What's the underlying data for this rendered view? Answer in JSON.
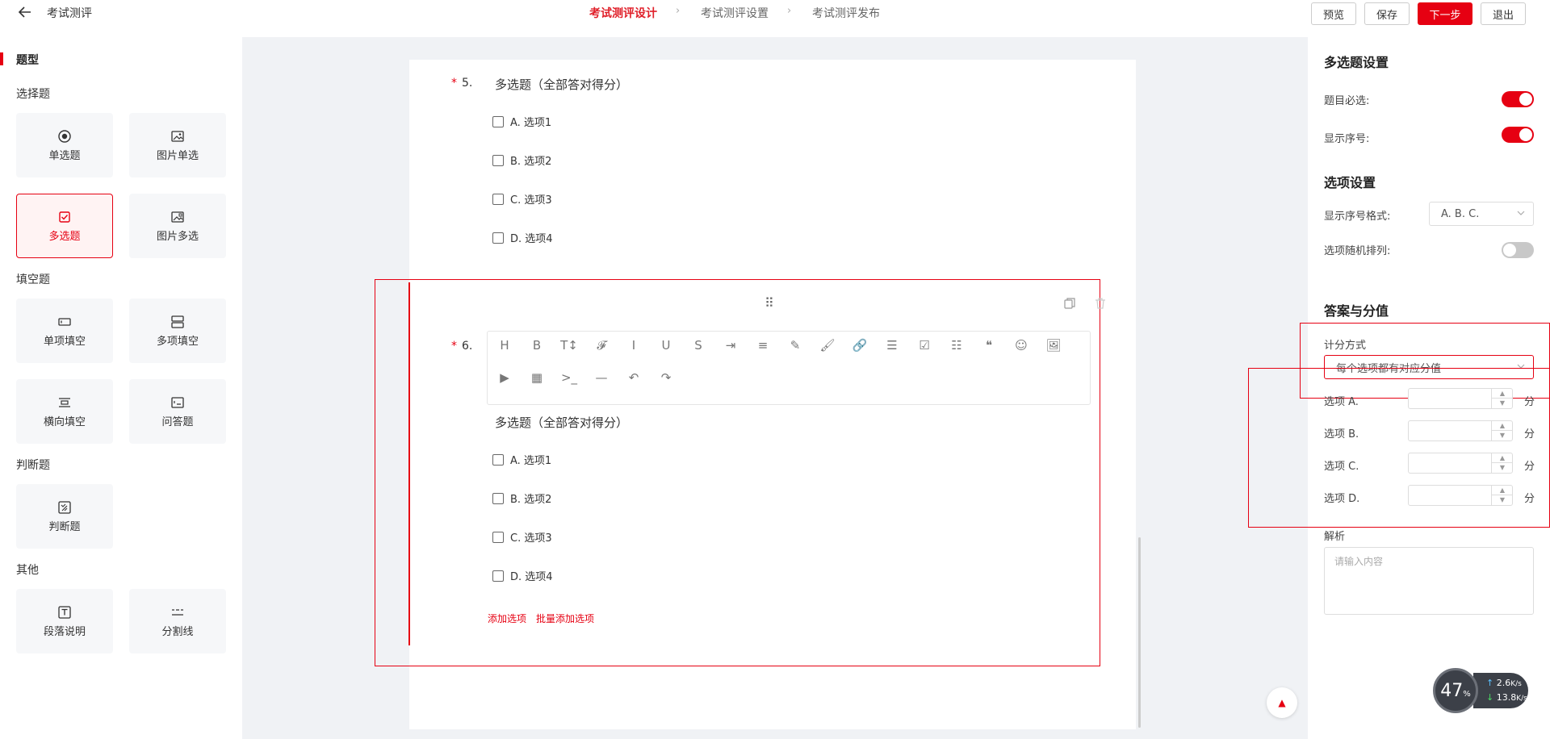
{
  "header": {
    "back_label": "←",
    "title": "考试测评",
    "steps": [
      "考试测评设计",
      "考试测评设置",
      "考试测评发布"
    ],
    "step_sep": "›",
    "buttons": {
      "preview": "预览",
      "save": "保存",
      "next": "下一步",
      "exit": "退出"
    }
  },
  "palette": {
    "title": "题型",
    "groups": {
      "choice": "选择题",
      "fill": "填空题",
      "judge": "判断题",
      "other": "其他"
    },
    "items": {
      "single": "单选题",
      "image_single": "图片单选",
      "multi": "多选题",
      "image_multi": "图片多选",
      "single_fill": "单项填空",
      "multi_fill": "多项填空",
      "horizontal_fill": "横向填空",
      "qa": "问答题",
      "judge": "判断题",
      "paragraph": "段落说明",
      "divider": "分割线"
    },
    "active_item": "multi",
    "accent": "#e60012"
  },
  "canvas": {
    "q5": {
      "number": "5.",
      "required_mark": "*",
      "title": "多选题（全部答对得分）",
      "options": [
        "A. 选项1",
        "B. 选项2",
        "C. 选项3",
        "D. 选项4"
      ]
    },
    "q6": {
      "number": "6.",
      "required_mark": "*",
      "title": "多选题（全部答对得分）",
      "options": [
        "A. 选项1",
        "B. 选项2",
        "C. 选项3",
        "D. 选项4"
      ],
      "add_option": "添加选项",
      "batch_add_option": "批量添加选项",
      "toolbar_row1": [
        "H",
        "B",
        "T↕",
        "𝓕",
        "I",
        "U",
        "S",
        "⇥",
        "≡",
        "✎",
        "🖌",
        "🔗",
        "☰",
        "☑",
        "☷",
        "❝",
        "☺",
        "🖼"
      ],
      "toolbar_row2": [
        "▶",
        "▦",
        ">_",
        "—",
        "↶",
        "↷"
      ],
      "drag_handle": "⠿"
    },
    "scroll_top": "▲"
  },
  "settings": {
    "multi_title": "多选题设置",
    "required_label": "题目必选:",
    "required_on": true,
    "show_number_label": "显示序号:",
    "show_number_on": true,
    "option_title": "选项设置",
    "number_format_label": "显示序号格式:",
    "number_format_value": "A. B. C.",
    "random_order_label": "选项随机排列:",
    "random_order_on": false,
    "score_title": "答案与分值",
    "scoring_label": "计分方式",
    "scoring_value": "每个选项都有对应分值",
    "option_scores": [
      {
        "label": "选项 A.",
        "unit": "分"
      },
      {
        "label": "选项 B.",
        "unit": "分"
      },
      {
        "label": "选项 C.",
        "unit": "分"
      },
      {
        "label": "选项 D.",
        "unit": "分"
      }
    ],
    "analysis_label": "解析",
    "analysis_placeholder": "请输入内容"
  },
  "speed_widget": {
    "percent": "47",
    "percent_unit": "%",
    "upload": "2.6",
    "upload_unit": "K/s",
    "download": "13.8",
    "download_unit": "K/s"
  }
}
